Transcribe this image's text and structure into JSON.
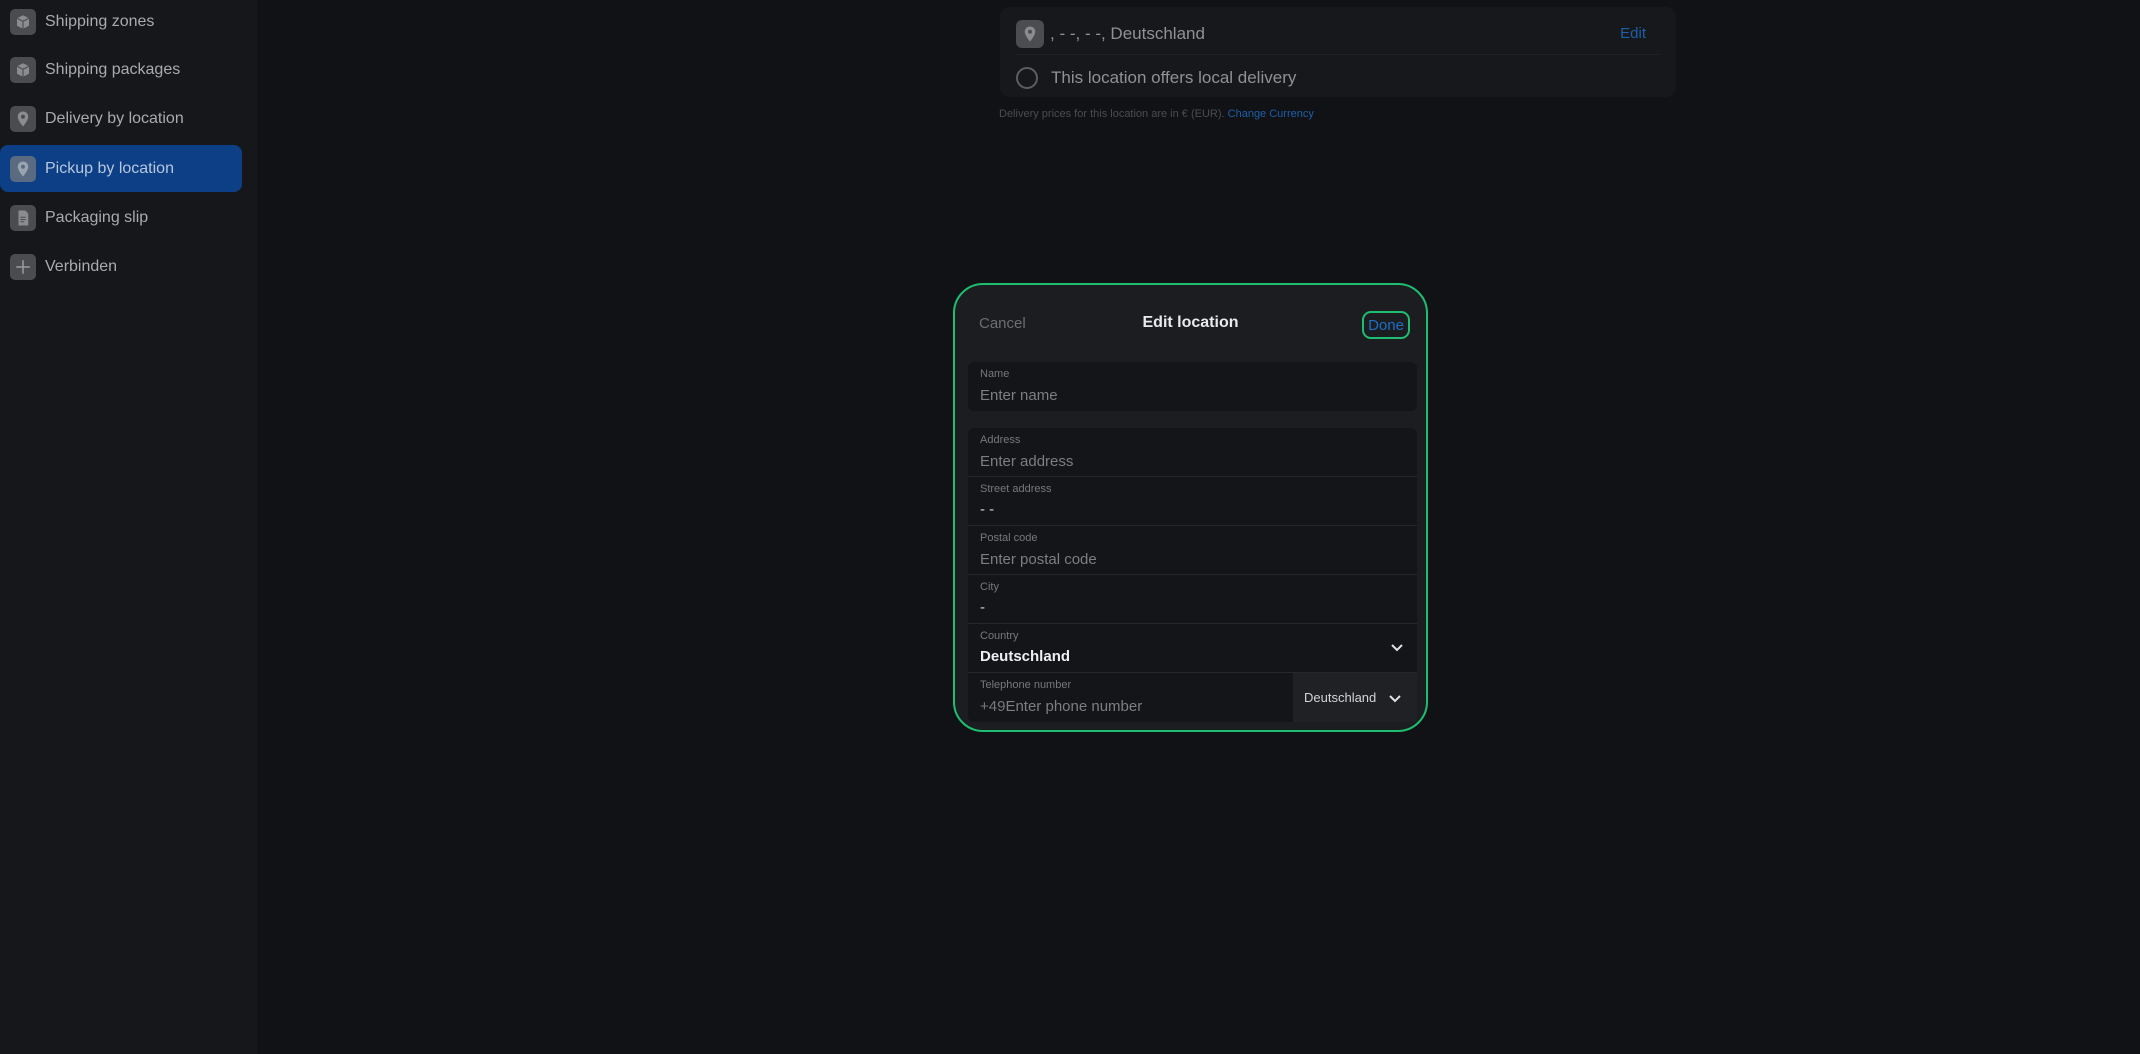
{
  "sidebar": {
    "items": [
      {
        "label": "Shipping zones",
        "icon": "box-icon",
        "active": false
      },
      {
        "label": "Shipping packages",
        "icon": "box-icon",
        "active": false
      },
      {
        "label": "Delivery by location",
        "icon": "location-pin-icon",
        "active": false
      },
      {
        "label": "Pickup by location",
        "icon": "location-pin-icon",
        "active": true
      },
      {
        "label": "Packaging slip",
        "icon": "document-icon",
        "active": false
      },
      {
        "label": "Verbinden",
        "icon": "plus-icon",
        "active": false
      }
    ]
  },
  "location_card": {
    "address": ", - -, - -, Deutschland",
    "edit_label": "Edit",
    "local_delivery_label": "This location offers local delivery"
  },
  "currency_note": {
    "text": "Delivery prices for this location are in € (EUR). ",
    "link": "Change Currency"
  },
  "modal": {
    "title": "Edit location",
    "cancel_label": "Cancel",
    "done_label": "Done",
    "name": {
      "label": "Name",
      "placeholder": "Enter name"
    },
    "address": {
      "label": "Address",
      "placeholder": "Enter address"
    },
    "street": {
      "label": "Street address",
      "value": "- -"
    },
    "postal": {
      "label": "Postal code",
      "placeholder": "Enter postal code"
    },
    "city": {
      "label": "City",
      "value": "-"
    },
    "country": {
      "label": "Country",
      "value": "Deutschland"
    },
    "phone": {
      "label": "Telephone number",
      "prefix": "+49",
      "placeholder": "Enter phone number",
      "country": "Deutschland"
    }
  },
  "colors": {
    "accent_green": "#1fbd6f",
    "active_nav": "#0c3f86",
    "link_blue": "#1d5fa8"
  }
}
